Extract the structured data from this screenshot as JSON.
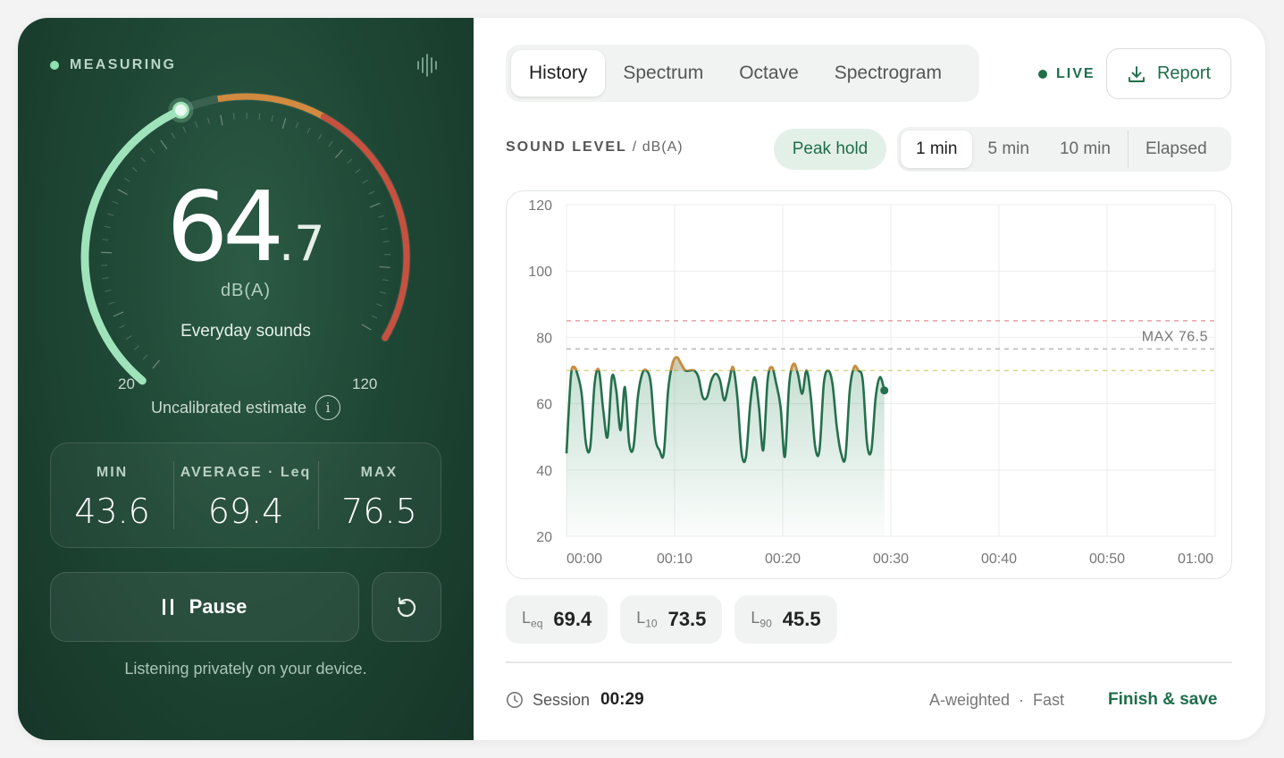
{
  "left": {
    "status": "MEASURING",
    "reading_int": "64",
    "reading_dec": ".7",
    "unit": "dB(A)",
    "category": "Everyday sounds",
    "scale_min": "20",
    "scale_max": "120",
    "calibration_note": "Uncalibrated estimate",
    "info_glyph": "i",
    "stats": [
      {
        "label": "MIN",
        "value": "43.6"
      },
      {
        "label": "AVERAGE · Leq",
        "value": "69.4"
      },
      {
        "label": "MAX",
        "value": "76.5"
      }
    ],
    "pause_label": "Pause",
    "privacy_note": "Listening privately on your device.",
    "gauge_value": 64.7,
    "colors": {
      "low": "#9fe3bb",
      "mid": "#d38a3e",
      "high": "#c8503e"
    }
  },
  "tabs": [
    "History",
    "Spectrum",
    "Octave",
    "Spectrogram"
  ],
  "active_tab": "History",
  "live_label": "LIVE",
  "report_label": "Report",
  "sound_level": {
    "title": "SOUND LEVEL",
    "unit": "/ dB(A)"
  },
  "peak_hold_label": "Peak hold",
  "ranges": [
    "1 min",
    "5 min",
    "10 min"
  ],
  "elapsed_label": "Elapsed",
  "chart_data": {
    "type": "line",
    "y_ticks": [
      "120",
      "100",
      "80",
      "60",
      "40",
      "20"
    ],
    "ylim": [
      20,
      120
    ],
    "x_ticks": [
      "00:00",
      "00:10",
      "00:20",
      "00:30",
      "00:40",
      "00:50",
      "01:00"
    ],
    "xlim": [
      0,
      60
    ],
    "max_label": "MAX 76.5",
    "reference_lines": [
      {
        "value": 85,
        "color": "#e8a0a0"
      },
      {
        "value": 76.5,
        "color": "#b8b8b8"
      },
      {
        "value": 70,
        "color": "#d9d68a"
      }
    ],
    "series": [
      {
        "x": [
          0,
          0.4,
          0.7,
          1.0,
          1.4,
          1.8,
          2.2,
          2.6,
          3.0,
          3.4,
          3.8,
          4.2,
          4.6,
          5.0,
          5.4,
          5.8,
          6.2,
          6.6,
          7.0,
          7.4,
          7.8,
          8.2,
          8.6,
          9.0,
          9.4,
          9.8,
          10.2,
          10.6,
          11.0,
          11.4,
          11.8,
          12.2,
          12.6,
          13.0,
          13.4,
          13.8,
          14.2,
          14.6,
          15.0,
          15.4,
          15.8,
          16.2,
          16.6,
          17.0,
          17.4,
          17.8,
          18.2,
          18.6,
          19.0,
          19.4,
          19.8,
          20.2,
          20.6,
          21.0,
          21.4,
          21.8,
          22.2,
          22.6,
          23.0,
          23.4,
          23.8,
          24.2,
          24.6,
          25.0,
          25.4,
          25.8,
          26.2,
          26.6,
          27.0,
          27.4,
          27.8,
          28.2,
          28.6,
          29.0,
          29.4
        ],
        "values": [
          45,
          68,
          71,
          69,
          63,
          48,
          47,
          66,
          70,
          58,
          50,
          68,
          64,
          52,
          65,
          48,
          47,
          62,
          69,
          70,
          66,
          50,
          46,
          45,
          64,
          72,
          74,
          72,
          70,
          70,
          70,
          68,
          62,
          62,
          67,
          69,
          67,
          61,
          66,
          71,
          62,
          45,
          44,
          60,
          68,
          59,
          46,
          67,
          71,
          66,
          59,
          44,
          66,
          72,
          69,
          63,
          70,
          62,
          47,
          46,
          66,
          70,
          66,
          53,
          45,
          44,
          64,
          71,
          70,
          67,
          48,
          46,
          62,
          68,
          64
        ]
      }
    ]
  },
  "chips": [
    {
      "key": "L",
      "sub": "eq",
      "value": "69.4"
    },
    {
      "key": "L",
      "sub": "10",
      "value": "73.5"
    },
    {
      "key": "L",
      "sub": "90",
      "value": "45.5"
    }
  ],
  "session": {
    "label": "Session",
    "time": "00:29"
  },
  "mode": "A-weighted  ·  Fast",
  "finish_label": "Finish & save"
}
